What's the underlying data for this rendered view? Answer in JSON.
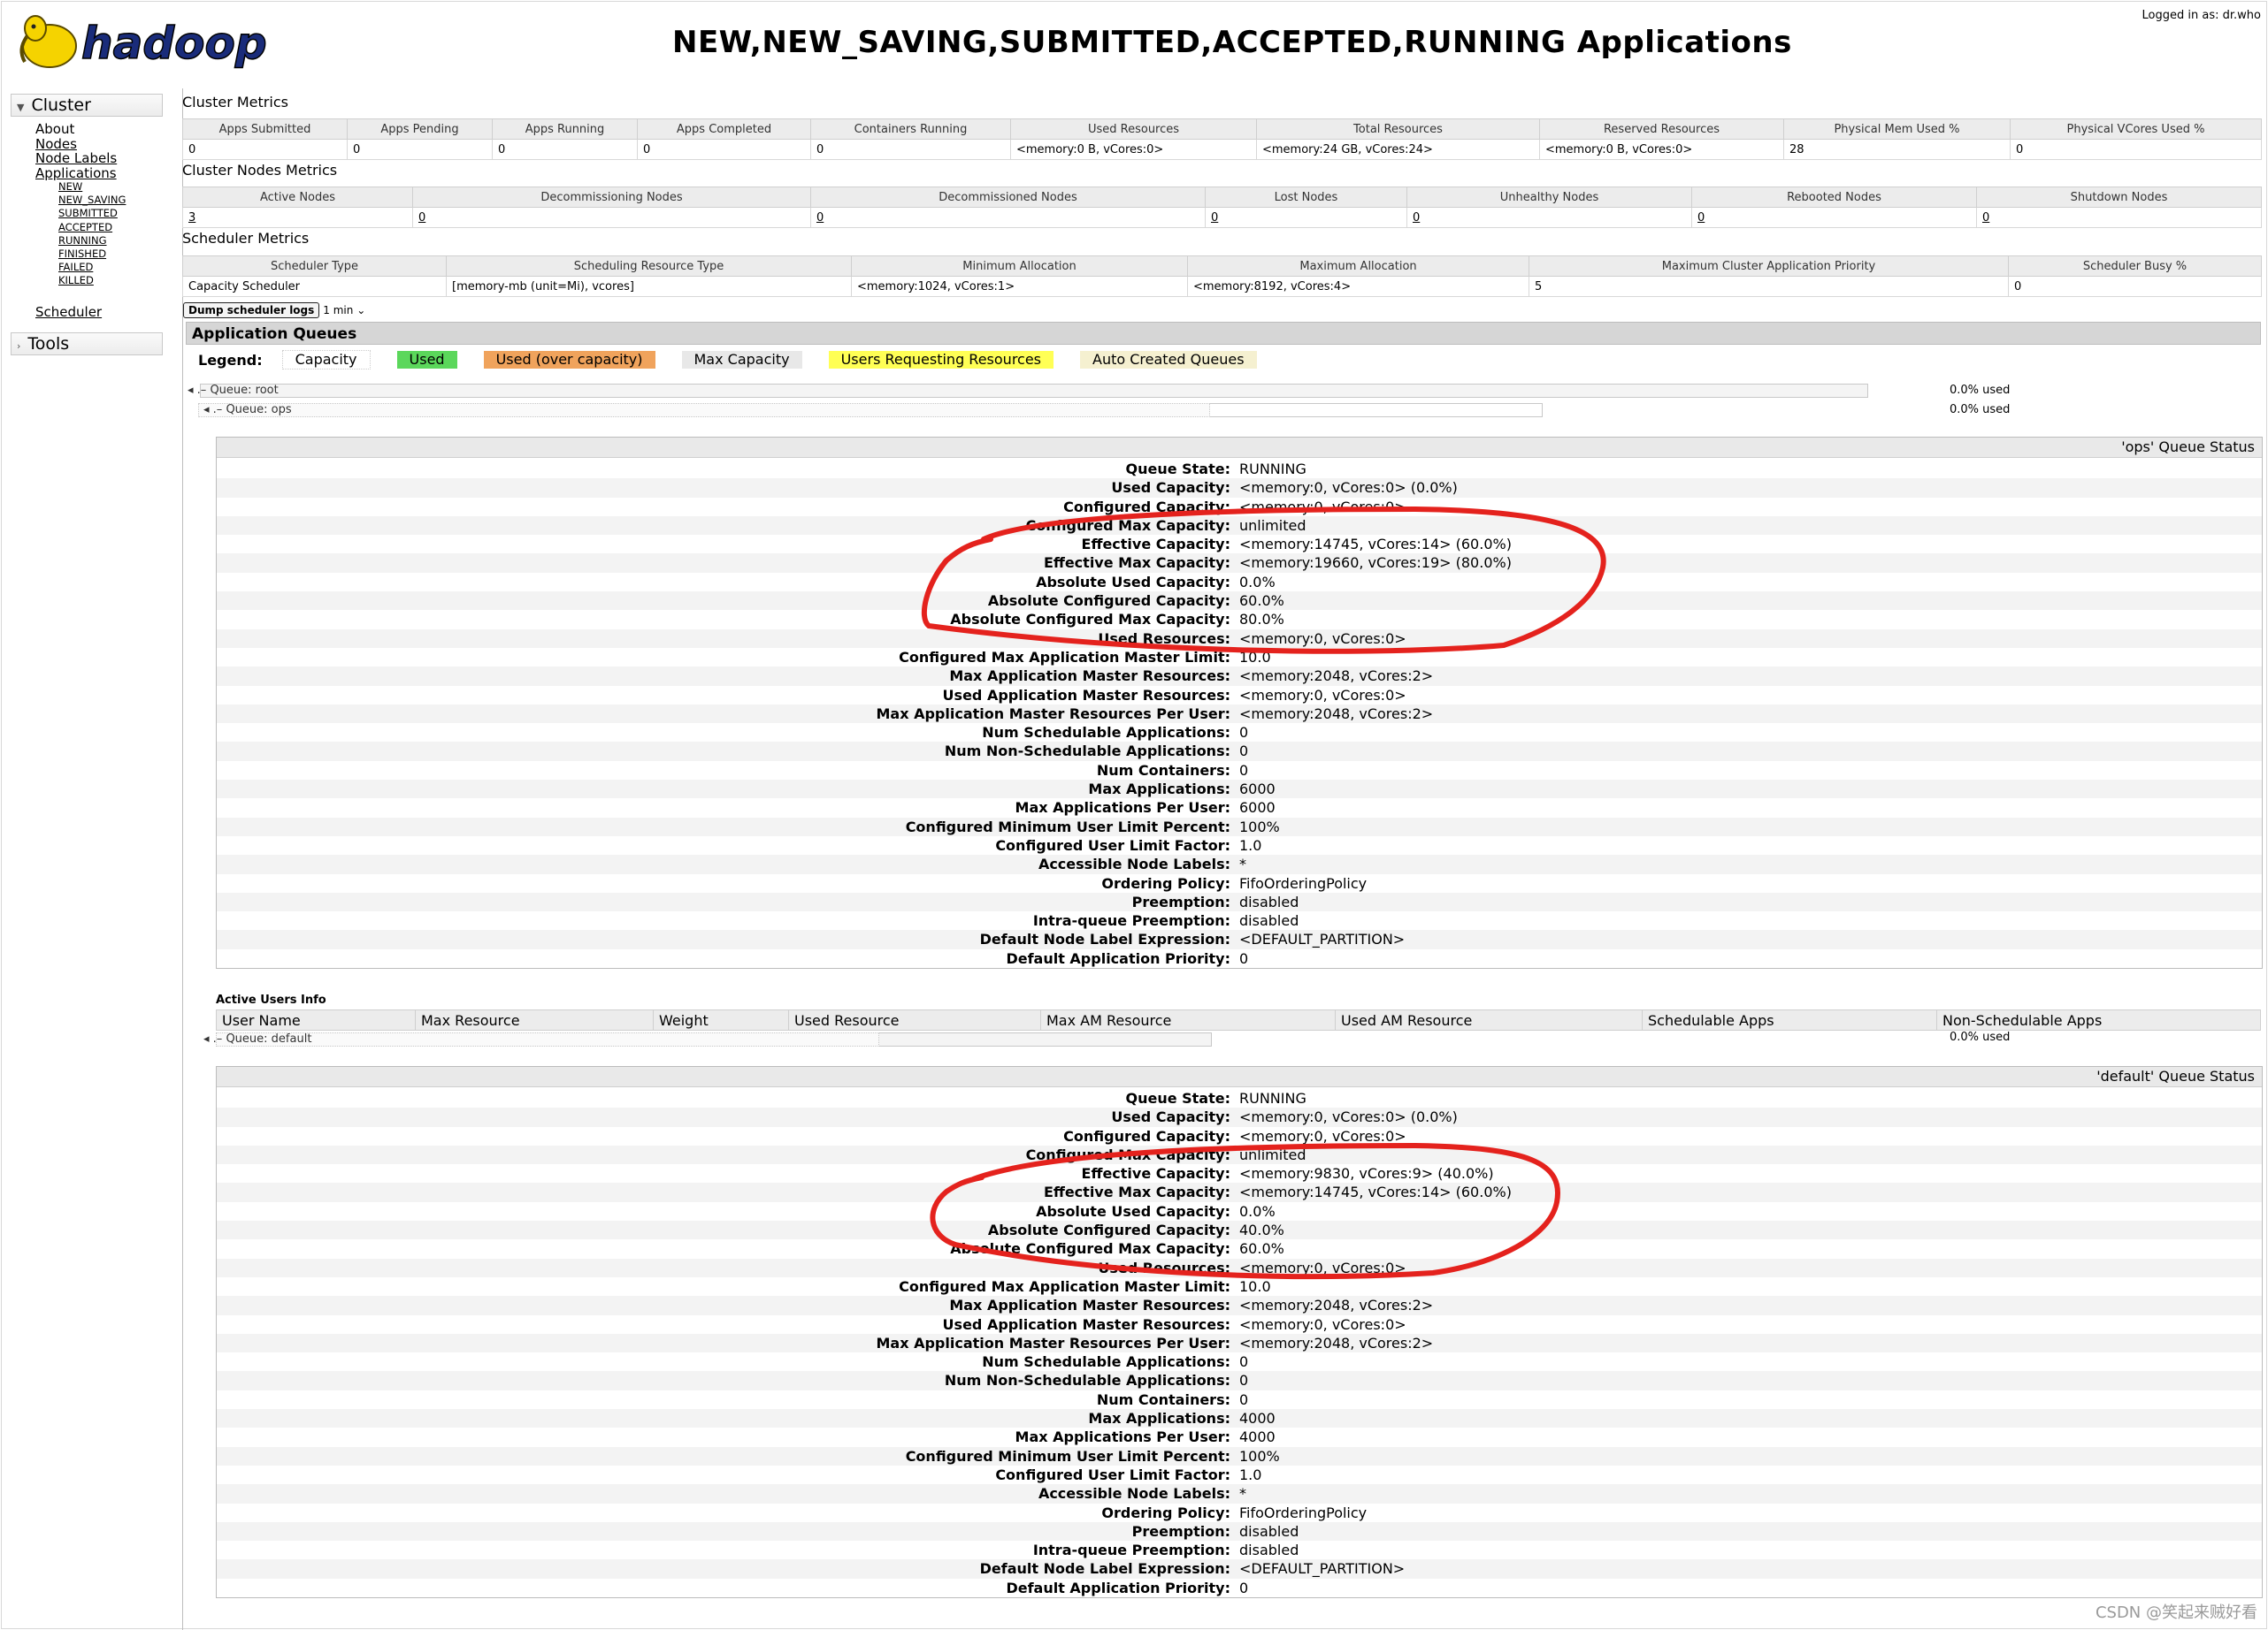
{
  "header": {
    "logo_text": "hadoop",
    "title": "NEW,NEW_SAVING,SUBMITTED,ACCEPTED,RUNNING Applications",
    "logged_in": "Logged in as: dr.who"
  },
  "sidebar": {
    "cluster_label": "Cluster",
    "links": [
      "About",
      "Nodes",
      "Node Labels",
      "Applications"
    ],
    "app_states": [
      "NEW",
      "NEW_SAVING",
      "SUBMITTED",
      "ACCEPTED",
      "RUNNING",
      "FINISHED",
      "FAILED",
      "KILLED"
    ],
    "scheduler_label": "Scheduler",
    "tools_label": "Tools"
  },
  "cluster_metrics": {
    "label": "Cluster Metrics",
    "headers": [
      "Apps Submitted",
      "Apps Pending",
      "Apps Running",
      "Apps Completed",
      "Containers Running",
      "Used Resources",
      "Total Resources",
      "Reserved Resources",
      "Physical Mem Used %",
      "Physical VCores Used %"
    ],
    "values": [
      "0",
      "0",
      "0",
      "0",
      "0",
      "<memory:0 B, vCores:0>",
      "<memory:24 GB, vCores:24>",
      "<memory:0 B, vCores:0>",
      "28",
      "0"
    ]
  },
  "node_metrics": {
    "label": "Cluster Nodes Metrics",
    "headers": [
      "Active Nodes",
      "Decommissioning Nodes",
      "Decommissioned Nodes",
      "Lost Nodes",
      "Unhealthy Nodes",
      "Rebooted Nodes",
      "Shutdown Nodes"
    ],
    "values": [
      "3",
      "0",
      "0",
      "0",
      "0",
      "0",
      "0"
    ]
  },
  "scheduler_metrics": {
    "label": "Scheduler Metrics",
    "headers": [
      "Scheduler Type",
      "Scheduling Resource Type",
      "Minimum Allocation",
      "Maximum Allocation",
      "Maximum Cluster Application Priority",
      "Scheduler Busy %"
    ],
    "values": [
      "Capacity Scheduler",
      "[memory-mb (unit=Mi), vcores]",
      "<memory:1024, vCores:1>",
      "<memory:8192, vCores:4>",
      "5",
      "0"
    ],
    "dump_button": "Dump scheduler logs",
    "dump_interval": "1 min"
  },
  "app_queues": {
    "heading": "Application Queues",
    "legend_label": "Legend:",
    "legend": [
      {
        "label": "Capacity",
        "color": "#ffffff"
      },
      {
        "label": "Used",
        "color": "#5bd75b"
      },
      {
        "label": "Used (over capacity)",
        "color": "#f0a35c"
      },
      {
        "label": "Max Capacity",
        "color": "#e8e8e8"
      },
      {
        "label": "Users Requesting Resources",
        "color": "#ffff55"
      },
      {
        "label": "Auto Created Queues",
        "color": "#f5f0d0"
      }
    ],
    "root": {
      "label": "Queue: root",
      "pct": "0.0% used"
    },
    "ops": {
      "label": "Queue: ops",
      "pct": "0.0% used"
    },
    "default": {
      "label": "Queue: default",
      "pct": "0.0% used"
    }
  },
  "ops_status": {
    "title": "'ops' Queue Status",
    "rows": [
      [
        "Queue State:",
        "RUNNING"
      ],
      [
        "Used Capacity:",
        "<memory:0, vCores:0> (0.0%)"
      ],
      [
        "Configured Capacity:",
        "<memory:0, vCores:0>"
      ],
      [
        "Configured Max Capacity:",
        "unlimited"
      ],
      [
        "Effective Capacity:",
        "<memory:14745, vCores:14> (60.0%)"
      ],
      [
        "Effective Max Capacity:",
        "<memory:19660, vCores:19> (80.0%)"
      ],
      [
        "Absolute Used Capacity:",
        "0.0%"
      ],
      [
        "Absolute Configured Capacity:",
        "60.0%"
      ],
      [
        "Absolute Configured Max Capacity:",
        "80.0%"
      ],
      [
        "Used Resources:",
        "<memory:0, vCores:0>"
      ],
      [
        "Configured Max Application Master Limit:",
        "10.0"
      ],
      [
        "Max Application Master Resources:",
        "<memory:2048, vCores:2>"
      ],
      [
        "Used Application Master Resources:",
        "<memory:0, vCores:0>"
      ],
      [
        "Max Application Master Resources Per User:",
        "<memory:2048, vCores:2>"
      ],
      [
        "Num Schedulable Applications:",
        "0"
      ],
      [
        "Num Non-Schedulable Applications:",
        "0"
      ],
      [
        "Num Containers:",
        "0"
      ],
      [
        "Max Applications:",
        "6000"
      ],
      [
        "Max Applications Per User:",
        "6000"
      ],
      [
        "Configured Minimum User Limit Percent:",
        "100%"
      ],
      [
        "Configured User Limit Factor:",
        "1.0"
      ],
      [
        "Accessible Node Labels:",
        "*"
      ],
      [
        "Ordering Policy:",
        "FifoOrderingPolicy"
      ],
      [
        "Preemption:",
        "disabled"
      ],
      [
        "Intra-queue Preemption:",
        "disabled"
      ],
      [
        "Default Node Label Expression:",
        "<DEFAULT_PARTITION>"
      ],
      [
        "Default Application Priority:",
        "0"
      ]
    ]
  },
  "active_users": {
    "label": "Active Users Info",
    "headers": [
      "User Name",
      "Max Resource",
      "Weight",
      "Used Resource",
      "Max AM Resource",
      "Used AM Resource",
      "Schedulable Apps",
      "Non-Schedulable Apps"
    ]
  },
  "default_status": {
    "title": "'default' Queue Status",
    "rows": [
      [
        "Queue State:",
        "RUNNING"
      ],
      [
        "Used Capacity:",
        "<memory:0, vCores:0> (0.0%)"
      ],
      [
        "Configured Capacity:",
        "<memory:0, vCores:0>"
      ],
      [
        "Configured Max Capacity:",
        "unlimited"
      ],
      [
        "Effective Capacity:",
        "<memory:9830, vCores:9> (40.0%)"
      ],
      [
        "Effective Max Capacity:",
        "<memory:14745, vCores:14> (60.0%)"
      ],
      [
        "Absolute Used Capacity:",
        "0.0%"
      ],
      [
        "Absolute Configured Capacity:",
        "40.0%"
      ],
      [
        "Absolute Configured Max Capacity:",
        "60.0%"
      ],
      [
        "Used Resources:",
        "<memory:0, vCores:0>"
      ],
      [
        "Configured Max Application Master Limit:",
        "10.0"
      ],
      [
        "Max Application Master Resources:",
        "<memory:2048, vCores:2>"
      ],
      [
        "Used Application Master Resources:",
        "<memory:0, vCores:0>"
      ],
      [
        "Max Application Master Resources Per User:",
        "<memory:2048, vCores:2>"
      ],
      [
        "Num Schedulable Applications:",
        "0"
      ],
      [
        "Num Non-Schedulable Applications:",
        "0"
      ],
      [
        "Num Containers:",
        "0"
      ],
      [
        "Max Applications:",
        "4000"
      ],
      [
        "Max Applications Per User:",
        "4000"
      ],
      [
        "Configured Minimum User Limit Percent:",
        "100%"
      ],
      [
        "Configured User Limit Factor:",
        "1.0"
      ],
      [
        "Accessible Node Labels:",
        "*"
      ],
      [
        "Ordering Policy:",
        "FifoOrderingPolicy"
      ],
      [
        "Preemption:",
        "disabled"
      ],
      [
        "Intra-queue Preemption:",
        "disabled"
      ],
      [
        "Default Node Label Expression:",
        "<DEFAULT_PARTITION>"
      ],
      [
        "Default Application Priority:",
        "0"
      ]
    ]
  },
  "watermark": "CSDN @笑起来贼好看"
}
